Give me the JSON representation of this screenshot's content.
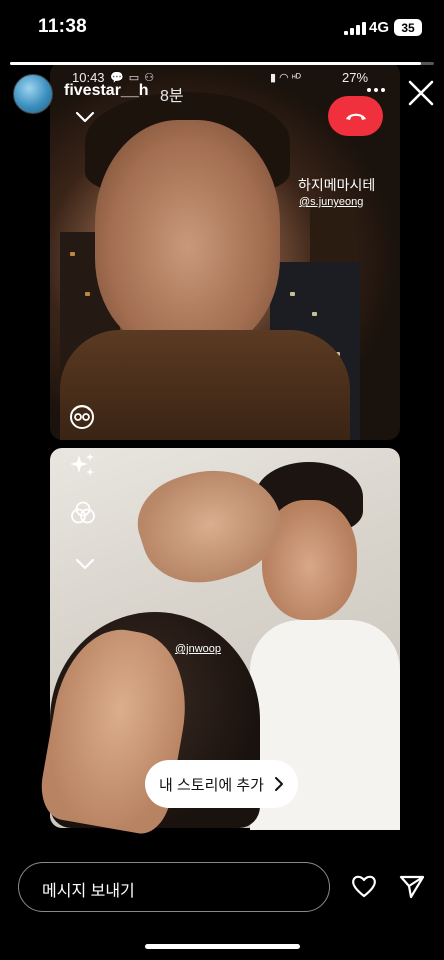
{
  "status_bar": {
    "time": "11:38",
    "network": "4G",
    "battery": "35"
  },
  "story": {
    "progress": 0.97,
    "username": "fivestar__h",
    "time_ago": "8분"
  },
  "inner_screenshot": {
    "time": "10:43",
    "status_icons": "💬 ▭ ⚇",
    "status_right": "▮ ◠ ᵸᴰ",
    "battery": "27%"
  },
  "video_call": {
    "text_sticker": "하지메마시테",
    "mention_top": "@s.junyeong",
    "mention_bottom": "@jnwoop",
    "add_story_label": "내 스토리에 추가"
  },
  "bottom": {
    "message_placeholder": "메시지 보내기"
  },
  "icons": {
    "end_call": "phone-hangup-icon",
    "collapse": "chevron-down-icon",
    "effects": "face-effect-icon",
    "sparkle": "sparkle-icon",
    "filters": "filter-icon",
    "heart": "heart-icon",
    "send": "send-icon",
    "close": "close-icon",
    "more": "more-icon"
  },
  "colors": {
    "end_call": "#f0303c",
    "background": "#000000"
  }
}
